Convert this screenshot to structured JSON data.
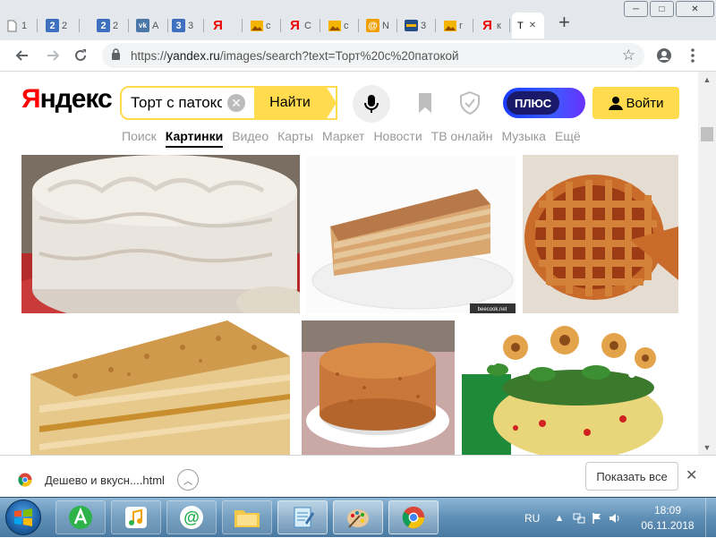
{
  "browser": {
    "tabs": [
      {
        "favicon": "doc-icon",
        "title": "1",
        "color": "#7a7a7a"
      },
      {
        "favicon": "2",
        "title": "2",
        "color": "#3f6fbf"
      },
      {
        "favicon": "2",
        "title": "2",
        "color": "#3f6fbf"
      },
      {
        "favicon": "vk",
        "title": "А",
        "color": "#4a76a8"
      },
      {
        "favicon": "3",
        "title": "3",
        "color": "#3f6fbf"
      },
      {
        "favicon": "Я",
        "title": "",
        "color": "#e00"
      },
      {
        "favicon": "image-icon",
        "title": "с",
        "color": "#f0a000"
      },
      {
        "favicon": "Я",
        "title": "С",
        "color": "#e00"
      },
      {
        "favicon": "image-icon",
        "title": "с",
        "color": "#f0a000"
      },
      {
        "favicon": "@",
        "title": "N",
        "color": "#f0a000"
      },
      {
        "favicon": "site-icon",
        "title": "3",
        "color": "#244d8a"
      },
      {
        "favicon": "image-icon",
        "title": "r",
        "color": "#f0a000"
      },
      {
        "favicon": "Я",
        "title": "к",
        "color": "#e00"
      },
      {
        "favicon": "",
        "title": "T",
        "color": "#fff",
        "active": true
      }
    ],
    "new_tab_label": "+",
    "window_controls": {
      "minimize": "─",
      "maximize": "□",
      "close": "✕"
    },
    "url": {
      "scheme": "https://",
      "host": "yandex.ru",
      "path": "/images/search?text=Торт%20с%20патокой"
    }
  },
  "yandex": {
    "logo_first": "Я",
    "logo_rest": "ндекс",
    "search_value": "Торт с патокой",
    "find_label": "Найти",
    "plus_label": "ПЛЮС",
    "login_label": "Войти",
    "nav": [
      {
        "label": "Поиск",
        "active": false
      },
      {
        "label": "Картинки",
        "active": true
      },
      {
        "label": "Видео",
        "active": false
      },
      {
        "label": "Карты",
        "active": false
      },
      {
        "label": "Маркет",
        "active": false
      },
      {
        "label": "Новости",
        "active": false
      },
      {
        "label": "ТВ онлайн",
        "active": false
      },
      {
        "label": "Музыка",
        "active": false
      },
      {
        "label": "Ещё",
        "active": false
      }
    ],
    "results": [
      {
        "name": "cake-white-frosting"
      },
      {
        "name": "honey-cake-slice",
        "watermark": "beecook.net"
      },
      {
        "name": "lattice-pie"
      },
      {
        "name": "nut-crumb-cake-slice"
      },
      {
        "name": "honey-cake-round"
      },
      {
        "name": "flower-decorated-cake"
      }
    ]
  },
  "download_shelf": {
    "filename": "Дешево и вкусн....html",
    "show_all_label": "Показать все",
    "close_label": "✕"
  },
  "taskbar": {
    "language": "RU",
    "time": "18:09",
    "date": "06.11.2018"
  }
}
